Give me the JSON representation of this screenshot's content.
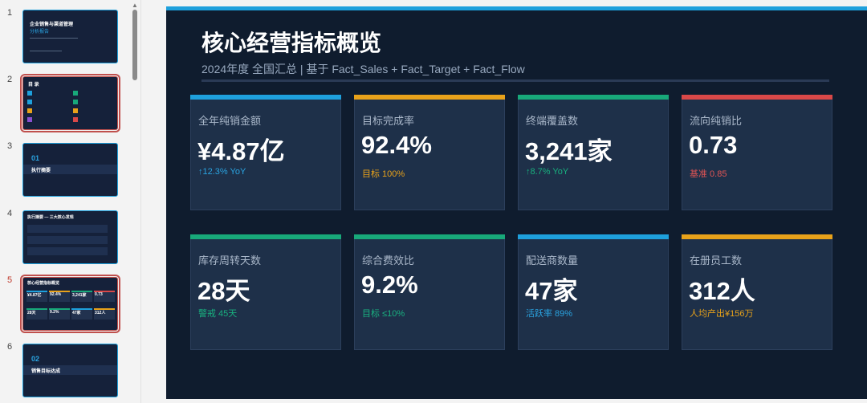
{
  "thumbnails": [
    {
      "num": "1",
      "title": "企业销售与渠道管理",
      "subtitle": "分析报告",
      "active": false
    },
    {
      "num": "2",
      "title": "目 录",
      "active": true
    },
    {
      "num": "3",
      "big": "01",
      "title": "执行摘要",
      "active": false
    },
    {
      "num": "4",
      "title": "执行摘要 — 三大核心发现",
      "active": false
    },
    {
      "num": "5",
      "title": "核心经营指标概览",
      "active": true
    },
    {
      "num": "6",
      "big": "02",
      "title": "销售目标达成",
      "active": false
    }
  ],
  "slide": {
    "title": "核心经营指标概览",
    "subtitle": "2024年度 全国汇总 | 基于 Fact_Sales + Fact_Target + Fact_Flow",
    "cards": [
      {
        "label": "全年纯销金额",
        "value": "¥4.87亿",
        "note": "↑12.3% YoY",
        "accent": "#1ea0dc",
        "note_color": "#2aa3e0"
      },
      {
        "label": "目标完成率",
        "value": "92.4%",
        "note": "目标 100%",
        "accent": "#e8a21a",
        "note_color": "#e8a21a"
      },
      {
        "label": "终端覆盖数",
        "value": "3,241家",
        "note": "↑8.7% YoY",
        "accent": "#18a97a",
        "note_color": "#19b07f"
      },
      {
        "label": "流向纯销比",
        "value": "0.73",
        "note": "基准 0.85",
        "accent": "#d94848",
        "note_color": "#e05454"
      },
      {
        "label": "库存周转天数",
        "value": "28天",
        "note": "警戒 45天",
        "accent": "#18a97a",
        "note_color": "#19b07f"
      },
      {
        "label": "综合费效比",
        "value": "9.2%",
        "note": "目标 ≤10%",
        "accent": "#18a97a",
        "note_color": "#19b07f"
      },
      {
        "label": "配送商数量",
        "value": "47家",
        "note": "活跃率 89%",
        "accent": "#1ea0dc",
        "note_color": "#2aa3e0"
      },
      {
        "label": "在册员工数",
        "value": "312人",
        "note": "人均产出¥156万",
        "accent": "#e8a21a",
        "note_color": "#e8a21a"
      }
    ]
  }
}
